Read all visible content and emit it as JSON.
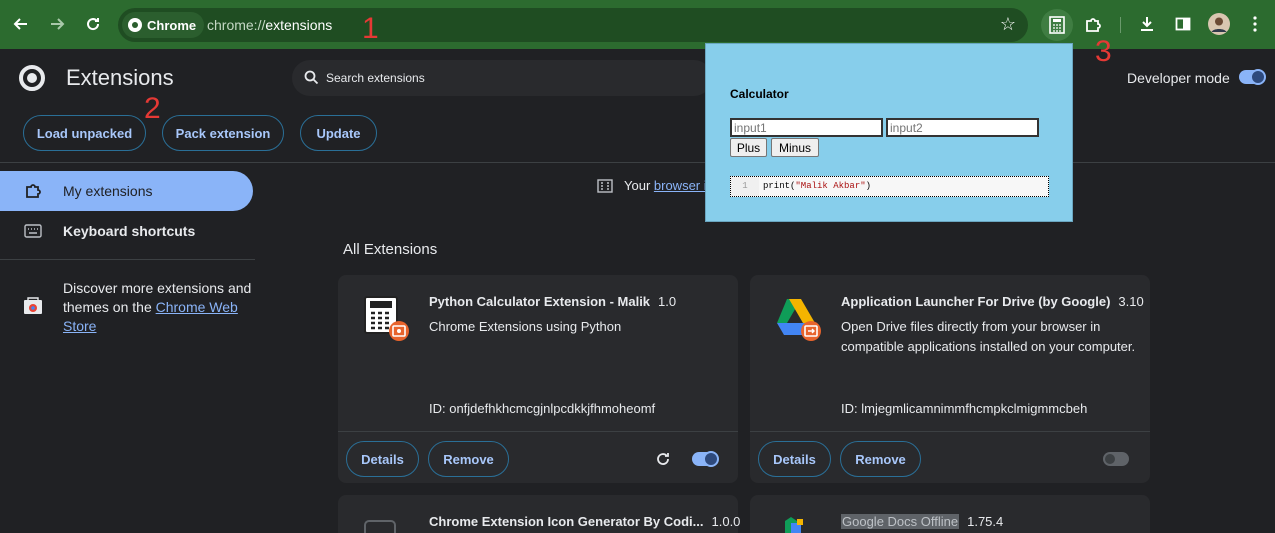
{
  "browser": {
    "chip_label": "Chrome",
    "url_scheme": "chrome://",
    "url_path": "extensions"
  },
  "annotations": [
    "1",
    "2",
    "3"
  ],
  "header": {
    "title": "Extensions",
    "search_placeholder": "Search extensions",
    "developer_mode_label": "Developer mode",
    "developer_mode_on": true
  },
  "actions": {
    "load_unpacked": "Load unpacked",
    "pack_extension": "Pack extension",
    "update": "Update"
  },
  "sidebar": {
    "items": [
      {
        "label": "My extensions",
        "icon": "puzzle-icon",
        "active": true
      },
      {
        "label": "Keyboard shortcuts",
        "icon": "keyboard-icon",
        "active": false
      }
    ],
    "discover_text": "Discover more extensions and themes on the ",
    "store_link": "Chrome Web Store"
  },
  "managed_notice": {
    "prefix": "Your ",
    "link": "browser i"
  },
  "section_title": "All Extensions",
  "extensions": [
    {
      "name": "Python Calculator Extension - Malik",
      "version": "1.0",
      "description": "Chrome Extensions using Python",
      "id_text": "ID: onfjdefhkhcmcgjnlpcdkkjfhmoheomf",
      "details": "Details",
      "remove": "Remove",
      "enabled": true
    },
    {
      "name": "Application Launcher For Drive (by Google)",
      "version": "3.10",
      "description": "Open Drive files directly from your browser in compatible applications installed on your computer.",
      "id_text": "ID: lmjegmlicamnimmfhcmpkclmigmmcbeh",
      "details": "Details",
      "remove": "Remove",
      "enabled": false
    },
    {
      "name": "Chrome Extension Icon Generator By Codi...",
      "version": "1.0.0"
    },
    {
      "name": "Google Docs Offline",
      "version": "1.75.4"
    }
  ],
  "popup": {
    "title": "Calculator",
    "input1_placeholder": "input1",
    "input2_placeholder": "input2",
    "plus": "Plus",
    "minus": "Minus",
    "code_line_number": "1",
    "code_fn": "print(",
    "code_string": "\"Malik Akbar\"",
    "code_close": ")"
  },
  "colors": {
    "toolbar": "#2c6b2f",
    "accent": "#8ab4f8",
    "annotation": "#e53935",
    "popup_bg": "#87ceeb"
  }
}
